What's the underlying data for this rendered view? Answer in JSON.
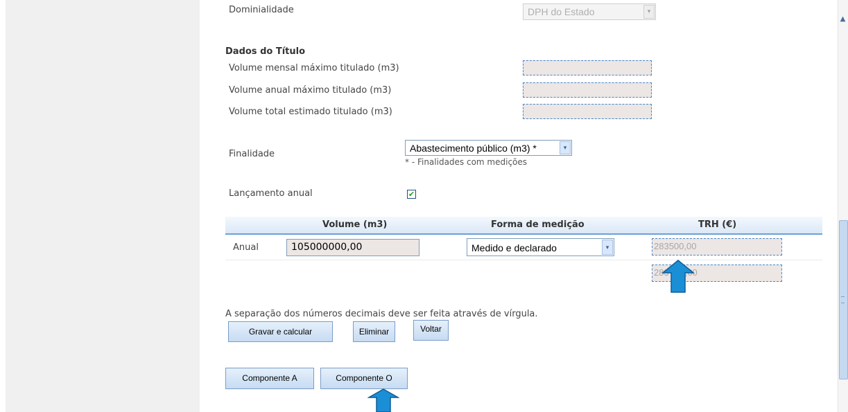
{
  "dominialidade": {
    "label": "Dominialidade",
    "value": "DPH do Estado"
  },
  "dados_titulo": {
    "title": "Dados do Título",
    "fields": [
      {
        "label": "Volume mensal máximo titulado (m3)"
      },
      {
        "label": "Volume anual máximo titulado (m3)"
      },
      {
        "label": "Volume total estimado titulado (m3)"
      }
    ]
  },
  "finalidade": {
    "label": "Finalidade",
    "value": "Abastecimento público (m3) *",
    "note": "* - Finalidades com medições"
  },
  "lancamento": {
    "label": "Lançamento anual",
    "checked": true
  },
  "table": {
    "headers": [
      "Volume (m3)",
      "Forma de medição",
      "TRH (€)"
    ],
    "rows": [
      {
        "label": "Anual",
        "volume": "105000000,00",
        "forma": "Medido e declarado",
        "trh": "283500,00"
      }
    ],
    "total_visible": "283",
    "total_visible_end": ",00"
  },
  "note": "A separação dos números decimais deve ser feita através de vírgula.",
  "buttons": {
    "gravar": "Gravar e calcular",
    "eliminar": "Eliminar",
    "voltar": "Voltar",
    "componente_a": "Componente A",
    "componente_o": "Componente O"
  },
  "icons": {
    "checkbox_mark": "✔",
    "dropdown": "▾",
    "scroll_up": "▲"
  },
  "colors": {
    "header_border": "#6aa1d6",
    "arrow": "#1b8fd6"
  }
}
